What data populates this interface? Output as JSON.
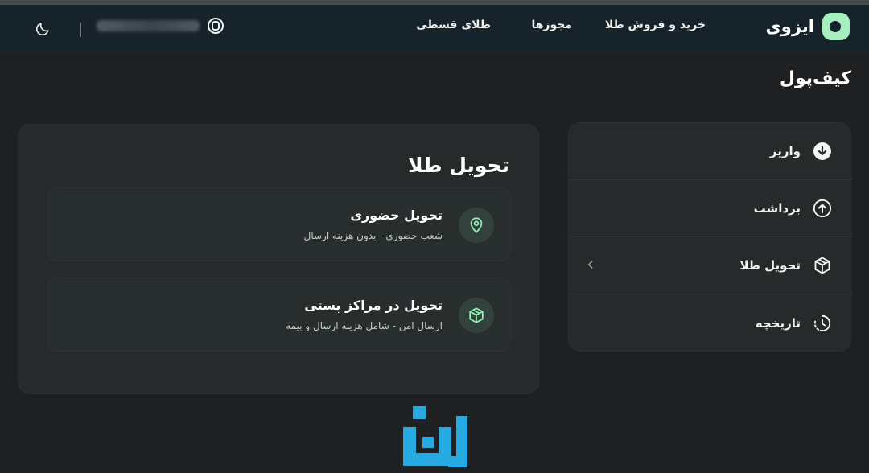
{
  "brand": {
    "name": "ایزوی"
  },
  "nav": {
    "items": [
      {
        "label": "خرید و فروش طلا"
      },
      {
        "label": "مجوزها"
      },
      {
        "label": "طلای قسطی"
      }
    ],
    "user_name": "",
    "icons": {
      "user": "user-circle-icon",
      "theme": "moon-icon"
    }
  },
  "page": {
    "title": "کیف‌پول"
  },
  "sidebar": {
    "items": [
      {
        "label": "واریز",
        "icon": "arrow-down-circle-icon"
      },
      {
        "label": "برداشت",
        "icon": "arrow-up-circle-icon"
      },
      {
        "label": "تحویل طلا",
        "icon": "box-icon",
        "active": true
      },
      {
        "label": "تاریخچه",
        "icon": "history-icon"
      }
    ]
  },
  "main": {
    "title": "تحویل طلا",
    "options": [
      {
        "title": "تحویل حضوری",
        "subtitle": "شعب حضوری - بدون هزینه ارسال",
        "icon": "map-pin-icon"
      },
      {
        "title": "تحویل در مراکز پستی",
        "subtitle": "ارسال امن - شامل هزینه ارسال و بیمه",
        "icon": "package-icon"
      }
    ]
  },
  "colors": {
    "background": "#1e2021",
    "navbar": "#17232a",
    "card": "#262a2b",
    "accent": "#8ff0b2",
    "watermark": "#27a9e1"
  }
}
